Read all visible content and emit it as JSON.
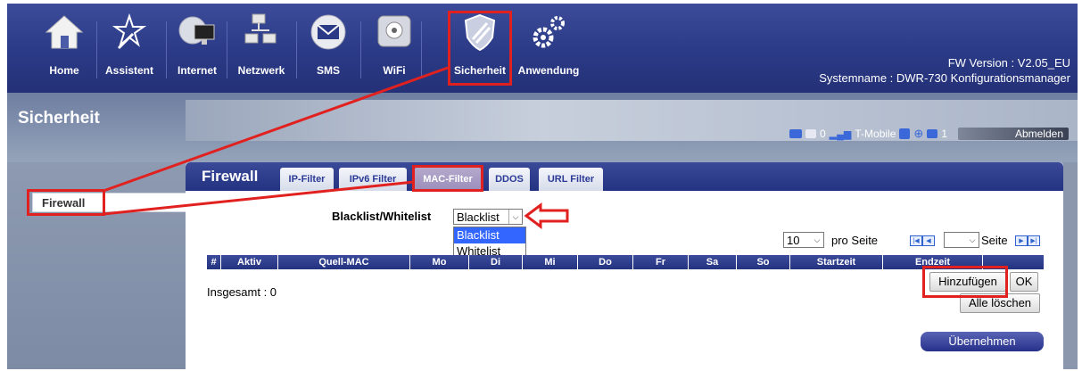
{
  "nav": {
    "items": [
      {
        "label": "Home",
        "icon": "home-icon"
      },
      {
        "label": "Assistent",
        "icon": "wand-icon"
      },
      {
        "label": "Internet",
        "icon": "globe-monitor-icon"
      },
      {
        "label": "Netzwerk",
        "icon": "network-computers-icon"
      },
      {
        "label": "SMS",
        "icon": "envelope-icon"
      },
      {
        "label": "WiFi",
        "icon": "wifi-antenna-icon"
      },
      {
        "label": "Sicherheit",
        "icon": "shield-icon"
      },
      {
        "label": "Anwendung",
        "icon": "gears-icon"
      }
    ],
    "active": "Sicherheit"
  },
  "header": {
    "fw_version": "FW Version : V2.05_EU",
    "system_name": "Systemname : DWR-730 Konfigurationsmanager"
  },
  "page": {
    "title": "Sicherheit"
  },
  "status": {
    "messages_count": "0",
    "carrier": "T-Mobile",
    "devices_count": "1",
    "logout_label": "Abmelden"
  },
  "sidebar": {
    "items": [
      {
        "label": "Firewall"
      }
    ]
  },
  "panel": {
    "title": "Firewall",
    "tabs": [
      {
        "label": "IP-Filter"
      },
      {
        "label": "IPv6 Filter"
      },
      {
        "label": "MAC-Filter"
      },
      {
        "label": "DDOS"
      },
      {
        "label": "URL Filter"
      }
    ],
    "active_tab": "MAC-Filter"
  },
  "filter": {
    "mode_label": "Blacklist/Whitelist",
    "mode_value": "Blacklist",
    "mode_options": [
      "Blacklist",
      "Whitelist"
    ]
  },
  "pager": {
    "per_page_value": "10",
    "per_page_label": "pro Seite",
    "page_value": "",
    "page_label": "Seite"
  },
  "table": {
    "columns": [
      "#",
      "Aktiv",
      "Quell-MAC",
      "Mo",
      "Di",
      "Mi",
      "Do",
      "Fr",
      "Sa",
      "So",
      "Startzeit",
      "Endzeit"
    ],
    "rows": [],
    "total_label": "Insgesamt : 0"
  },
  "buttons": {
    "add": "Hinzufügen",
    "ok": "OK",
    "delete_all": "Alle löschen",
    "apply": "Übernehmen"
  },
  "colors": {
    "header_blue": "#2b3a86",
    "highlight_red": "#e0211f",
    "active_tab": "#9a8dba"
  }
}
